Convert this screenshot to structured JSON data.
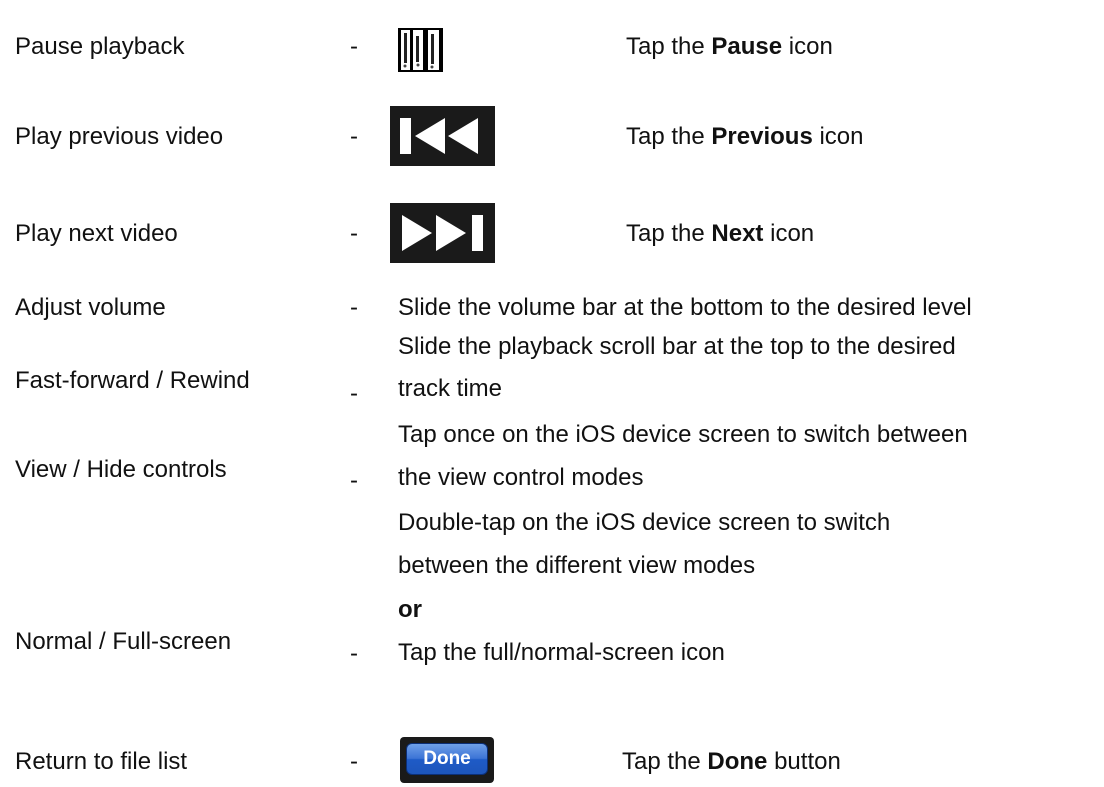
{
  "rows": {
    "pause": {
      "label": "Pause playback",
      "dash": "-",
      "tap_pre": "Tap the ",
      "tap_bold": "Pause",
      "tap_post": " icon"
    },
    "previous": {
      "label": "Play previous video",
      "dash": "-",
      "tap_pre": "Tap the ",
      "tap_bold": "Previous",
      "tap_post": " icon"
    },
    "next": {
      "label": "Play next video",
      "dash": "-",
      "tap_pre": "Tap the ",
      "tap_bold": "Next",
      "tap_post": " icon"
    },
    "volume": {
      "label": "Adjust volume",
      "dash": "-",
      "desc": "Slide the volume bar at the bottom to the desired level"
    },
    "seek": {
      "label": "Fast-forward / Rewind",
      "dash": "-",
      "desc_line1": "Slide the playback scroll bar at the top to the desired",
      "desc_line2": "track time"
    },
    "controls": {
      "label": "View / Hide controls",
      "dash": "-",
      "desc_line1": "Tap once on the iOS device screen to switch between",
      "desc_line2": "the view control modes"
    },
    "fullscreen": {
      "label": "Normal / Full-screen",
      "dash": "-",
      "desc_line1": "Double-tap on the iOS device screen to switch",
      "desc_line2": "between the different view modes",
      "or": "or",
      "desc_line3": "Tap the full/normal-screen icon"
    },
    "return": {
      "label": "Return to file list",
      "dash": "-",
      "tap_pre": "Tap the ",
      "tap_bold": "Done",
      "tap_post": " button",
      "button_label": "Done"
    }
  },
  "icons": {
    "pause": "pause-icon",
    "previous": "previous-icon",
    "next": "next-icon",
    "done": "done-button"
  },
  "colors": {
    "text": "#111111",
    "icon_bg": "#000000",
    "done_blue": "#2a63cc"
  }
}
